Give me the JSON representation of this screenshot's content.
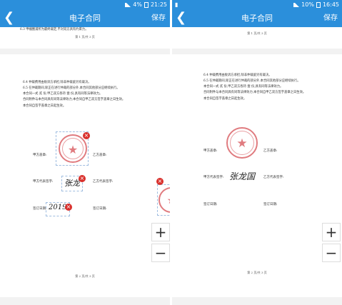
{
  "left": {
    "status": {
      "icons": "☰",
      "battery": "4%",
      "time": "21:25"
    },
    "header": {
      "title": "电子合同",
      "save_label": "保存",
      "back_icon": "back-arrow-icon"
    },
    "top_text": "6.3 甲幢圈浦所为最终裁定,不对双方具有约束力。",
    "top_footer": "第 1 页/共 3 页",
    "clauses": [
      "6.4 仲裁费用由败诉方承担,除非仲裁庭另有裁决。",
      "6.5 在仲裁期间,除正在进行仲裁的部分外,本合同其他部分应继续执行。",
      "本合同一式 贰 份,甲乙双方各持 壹 份,具有同等法律效力。",
      "合同附件与本合同具有同等法律效力,本合同自甲乙双方签字盖章之日生效。",
      "本合同自签字盖章之日起生效。"
    ],
    "labels": {
      "party_a_seal": "甲方盖章:",
      "party_b_seal": "乙方盖章:",
      "party_a_rep": "甲方代表签字:",
      "party_b_rep": "乙方代表签字:",
      "sign_date_a": "签订日期:",
      "sign_date_b": "签订日期:"
    },
    "signature": "张龙",
    "date_handwriting": "2019",
    "close_icon": "×",
    "bottom_footer": "第 2 页/共 3 页",
    "zoom_in": "+",
    "zoom_out": "−"
  },
  "right": {
    "status": {
      "icons": "☰",
      "battery": "10%",
      "time": "16:45"
    },
    "header": {
      "title": "电子合同",
      "save_label": "保存",
      "back_icon": "back-arrow-icon"
    },
    "top_footer": "第 1 页/共 3 页",
    "clauses": [
      "6.4 仲裁费用由败诉方承担,除非仲裁庭另有裁决。",
      "6.5 在仲裁期间,除正在进行仲裁的部分外,本合同其他部分应继续执行。",
      "本合同一式 贰 份,甲乙双方各持 壹 份,具有同等法律效力。",
      "合同附件与本合同具有同等法律效力,本合同自甲乙双方签字盖章之日生效。",
      "本合同自签字盖章之日起生效。"
    ],
    "labels": {
      "party_a_seal": "甲方盖章:",
      "party_b_seal": "乙方盖章:",
      "party_a_rep": "甲方代表签字:",
      "party_b_rep": "乙方代表签字:",
      "sign_date_a": "签订日期:",
      "sign_date_b": "签订日期:"
    },
    "signature": "张龙国",
    "bottom_footer": "第 2 页/共 3 页",
    "zoom_in": "+",
    "zoom_out": "−"
  },
  "colors": {
    "header": "#2b8fdb",
    "seal": "#e07b7f",
    "close": "#d9302c"
  }
}
